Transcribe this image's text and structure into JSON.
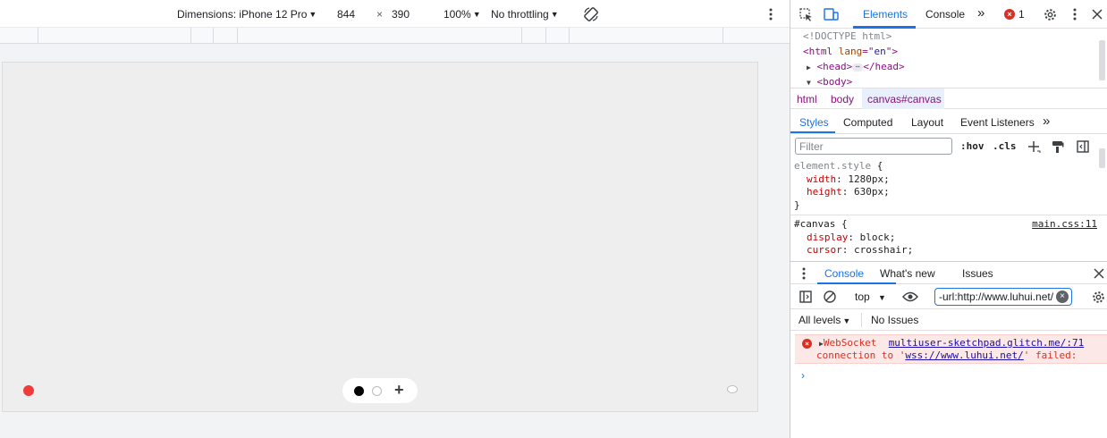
{
  "device_toolbar": {
    "dimensions_label": "Dimensions: iPhone 12 Pro",
    "width": "844",
    "times": "×",
    "height": "390",
    "zoom": "100%",
    "throttling": "No throttling"
  },
  "devtools": {
    "tabs": [
      "Elements",
      "Console"
    ],
    "more_tabs": "»",
    "error_count": "1",
    "dom": {
      "doctype": "<!DOCTYPE html>",
      "html_open_tag": "<html ",
      "html_attr_name": "lang",
      "html_attr_eq": "=\"",
      "html_attr_val": "en",
      "html_attr_close": "\">",
      "head_open": "<head>",
      "head_close": "</head>",
      "body_open": "<body>"
    },
    "breadcrumbs": [
      "html",
      "body",
      "canvas#canvas"
    ],
    "styles_tabs": [
      "Styles",
      "Computed",
      "Layout",
      "Event Listeners"
    ],
    "filter_placeholder": "Filter",
    "hov": ":hov",
    "cls": ".cls",
    "element_style": {
      "selector": "element.style",
      "open": " {",
      "props": [
        {
          "name": "width",
          "value": "1280px"
        },
        {
          "name": "height",
          "value": "630px"
        }
      ],
      "close": "}"
    },
    "canvas_rule": {
      "selector": "#canvas",
      "open": " {",
      "source": "main.css:11",
      "props": [
        {
          "name": "display",
          "value": "block"
        },
        {
          "name": "cursor",
          "value": "crosshair"
        }
      ]
    }
  },
  "drawer": {
    "tabs": [
      "Console",
      "What's new",
      "Issues"
    ],
    "context": "top",
    "filter_value": "-url:http://www.luhui.net/",
    "levels": "All levels",
    "no_issues": "No Issues",
    "error": {
      "prefix": "WebSocket",
      "source": "multiuser-sketchpad.glitch.me/:71",
      "line2_pre": "connection to '",
      "url": "wss://www.luhui.net/",
      "line2_post": "' failed:"
    },
    "prompt": "›"
  },
  "colors": {
    "accent": "#1a73e8",
    "error": "#d93025",
    "red_dot": "#ef3b3b"
  }
}
